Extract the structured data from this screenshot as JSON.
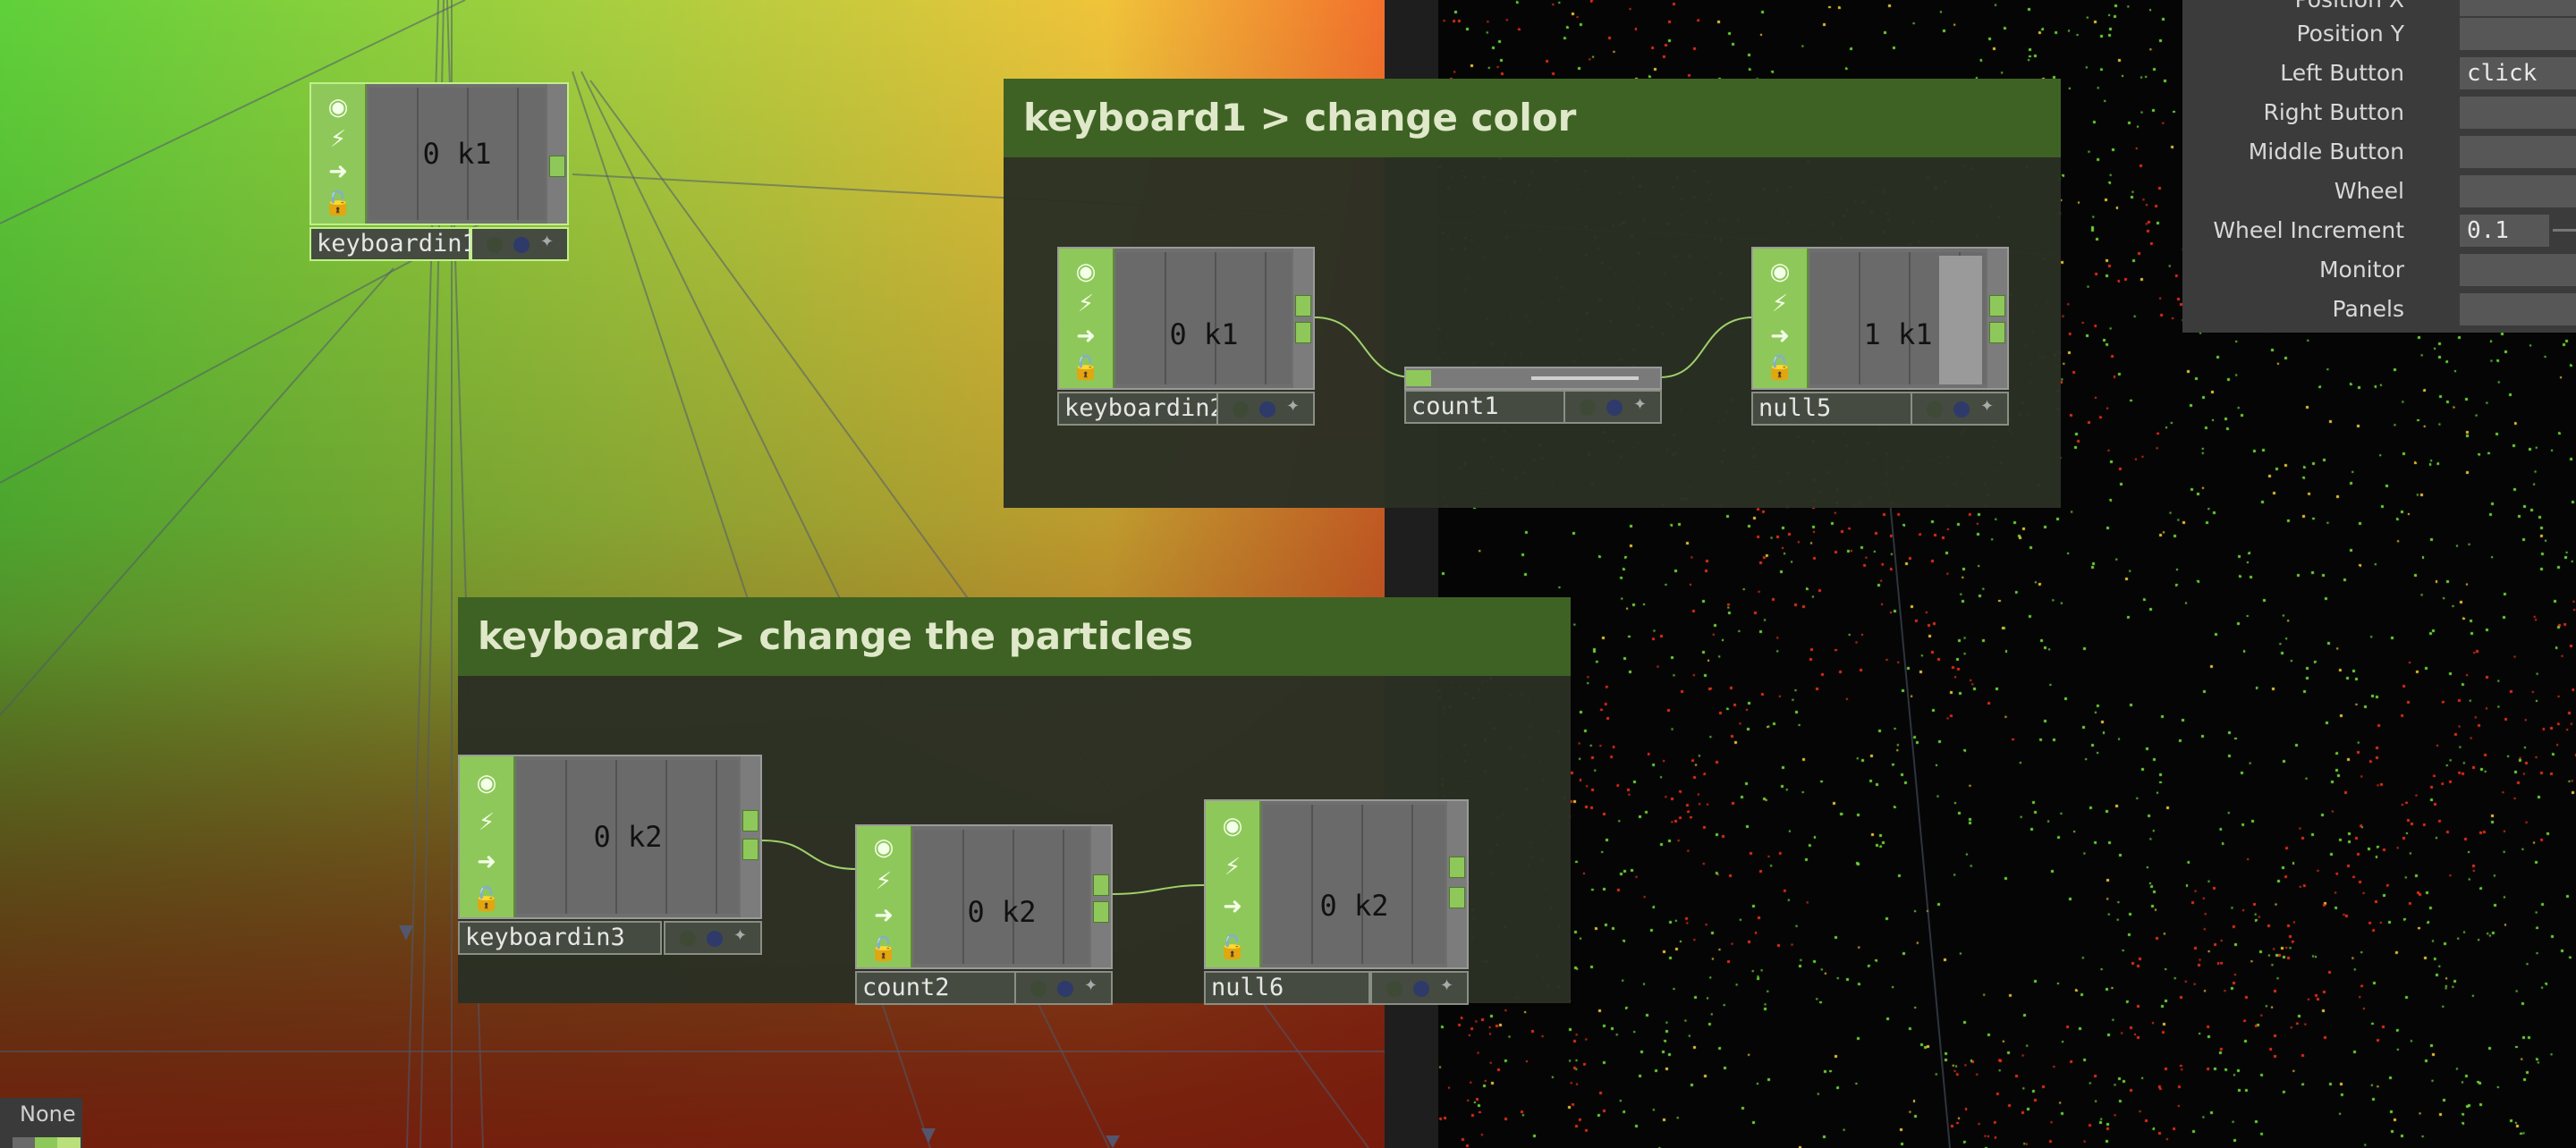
{
  "colors": {
    "accent": "#8fc85a",
    "comment_header": "#3e6224",
    "comment_body": "#2a3024",
    "node_body": "#6f6f6f"
  },
  "comments": [
    {
      "title": "keyboard1 > change color"
    },
    {
      "title": "keyboard2 > change the particles"
    }
  ],
  "operators": {
    "keyboardin1": {
      "name": "keyboardin1",
      "value": "0 k1"
    },
    "keyboardin2": {
      "name": "keyboardin2",
      "value": "0 k1"
    },
    "count1": {
      "name": "count1"
    },
    "null5": {
      "name": "null5",
      "value": "1 k1"
    },
    "keyboardin3": {
      "name": "keyboardin3",
      "value": "0 k2"
    },
    "count2": {
      "name": "count2",
      "value": "0 k2"
    },
    "null6": {
      "name": "null6",
      "value": "0 k2"
    }
  },
  "param_panel": {
    "rows": [
      {
        "label": "Position X",
        "value": ""
      },
      {
        "label": "Position Y",
        "value": ""
      },
      {
        "label": "Left Button",
        "value": "click"
      },
      {
        "label": "Right Button",
        "value": ""
      },
      {
        "label": "Middle Button",
        "value": ""
      },
      {
        "label": "Wheel",
        "value": ""
      },
      {
        "label": "Wheel Increment",
        "value": "0.1"
      },
      {
        "label": "Monitor",
        "value": ""
      },
      {
        "label": "Panels",
        "value": ""
      }
    ]
  },
  "status": {
    "none_label": "None"
  }
}
